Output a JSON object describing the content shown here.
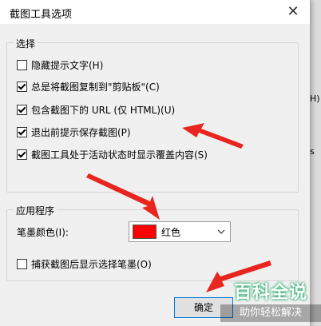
{
  "dialog": {
    "title": "截图工具选项",
    "close_glyph": "✕"
  },
  "selection": {
    "legend": "选择",
    "options": [
      {
        "label": "隐藏提示文字(H)",
        "checked": false
      },
      {
        "label": "总是将截图复制到\"剪贴板\"(C)",
        "checked": true
      },
      {
        "label": "包含截图下的 URL (仅 HTML)(U)",
        "checked": true
      },
      {
        "label": "退出前提示保存截图(P)",
        "checked": true
      },
      {
        "label": "截图工具处于活动状态时显示覆盖内容(S)",
        "checked": true
      }
    ]
  },
  "application": {
    "legend": "应用程序",
    "ink_color_label": "笔墨颜色(I):",
    "ink_color_value": "红色",
    "ink_color_hex": "#ff0000",
    "capture_ink_label": "捕获截图后显示选择笔墨(O)",
    "capture_ink_checked": false
  },
  "buttons": {
    "ok": "确定"
  },
  "background_peek": {
    "letter_h": "H)",
    "letter_s": "s"
  },
  "watermark": {
    "title": "百科全说",
    "subtitle": "助你轻松解决"
  },
  "colors": {
    "arrow": "#e8251e",
    "accent": "#0078d7"
  }
}
